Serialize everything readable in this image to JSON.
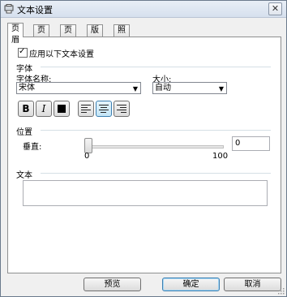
{
  "window": {
    "title": "文本设置",
    "close_glyph": "✕",
    "icon": "app-icon"
  },
  "tabs": [
    {
      "label": "页眉",
      "active": true
    },
    {
      "label": "页脚",
      "active": false
    },
    {
      "label": "页码",
      "active": false
    },
    {
      "label": "版权",
      "active": false
    },
    {
      "label": "照片信息",
      "active": false
    }
  ],
  "apply": {
    "label": "应用以下文本设置",
    "checked": true
  },
  "font": {
    "section": "字体",
    "name_label": "字体名称:",
    "name_value": "宋体",
    "size_label": "大小:",
    "size_value": "自动",
    "bold_glyph": "B",
    "italic_glyph": "I",
    "bold_checked": false,
    "italic_checked": false,
    "alignment": "center",
    "color": "#000000"
  },
  "position": {
    "section": "位置",
    "vertical_label": "垂直:",
    "slider_value": 0,
    "slider_min": "0",
    "slider_max": "100",
    "value": "0"
  },
  "text": {
    "section": "文本",
    "value": ""
  },
  "buttons": {
    "preview": "预览",
    "ok": "确定",
    "cancel": "取消"
  }
}
